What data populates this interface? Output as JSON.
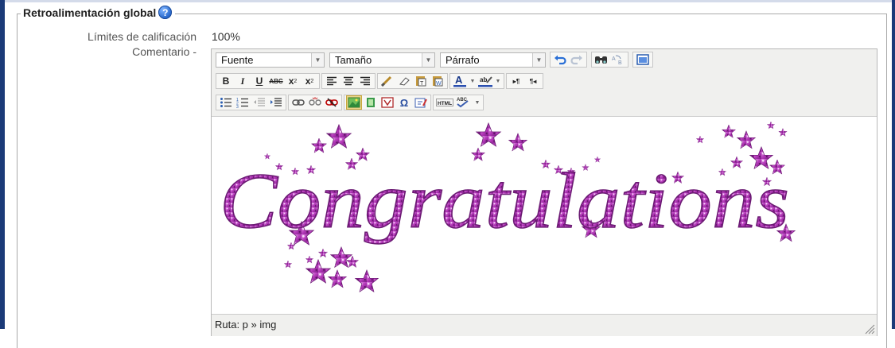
{
  "section": {
    "legend": "Retroalimentación global",
    "help_icon": "help-icon"
  },
  "fields": {
    "grade_limits_label": "Límites de calificación",
    "grade_limits_value": "100%",
    "comment_label": "Comentario -"
  },
  "editor": {
    "font_select": "Fuente",
    "size_select": "Tamaño",
    "format_select": "Párrafo",
    "image_text": "Congratulations",
    "status_path": "Ruta: p » img"
  },
  "colors": {
    "accent": "#2f6fd1",
    "frame": "#1b3a78",
    "glitter": "#c44bc4"
  }
}
